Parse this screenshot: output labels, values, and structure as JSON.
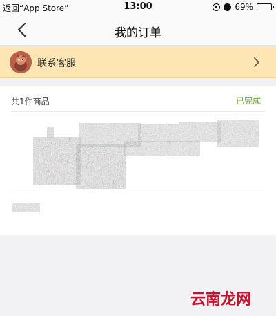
{
  "status_bar": {
    "back_to_app": "返回“App Store”",
    "time": "13:00",
    "battery": "69%",
    "battery_level": 0.69
  },
  "nav": {
    "title": "我的订单"
  },
  "service": {
    "label": "联系客服"
  },
  "order": {
    "count_text": "共1件商品",
    "status_text": "已完成",
    "status_color": "#6aae3a"
  },
  "watermark": {
    "text": "云南龙网"
  },
  "colors": {
    "banner": "#fde6b4",
    "page_bg": "#f2f2f4"
  }
}
